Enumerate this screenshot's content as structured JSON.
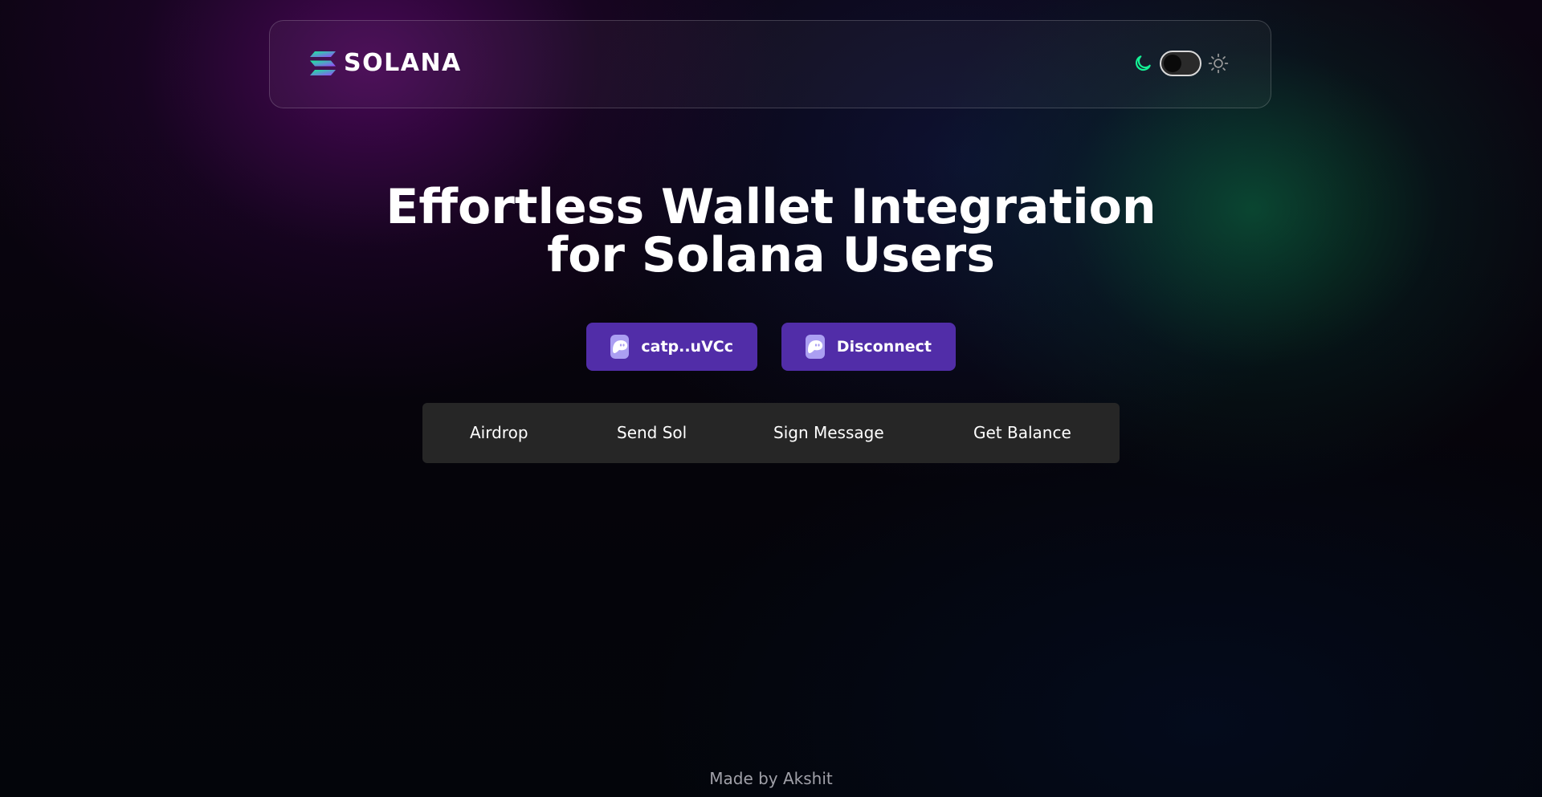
{
  "header": {
    "logo_text": "SOLANA",
    "theme": {
      "moon_icon": "moon-icon",
      "sun_icon": "sun-icon",
      "mode": "dark"
    }
  },
  "hero": {
    "title_line1": "Effortless Wallet Integration",
    "title_line2": "for Solana Users"
  },
  "wallet": {
    "address_label": "catp..uVCc",
    "disconnect_label": "Disconnect",
    "wallet_icon": "phantom-ghost-icon",
    "button_color": "#512da8"
  },
  "actions": [
    {
      "label": "Airdrop"
    },
    {
      "label": "Send Sol"
    },
    {
      "label": "Sign Message"
    },
    {
      "label": "Get Balance"
    }
  ],
  "footer": {
    "text": "Made by Akshit"
  },
  "colors": {
    "accent_green": "#14f195",
    "accent_purple": "#9945ff"
  }
}
